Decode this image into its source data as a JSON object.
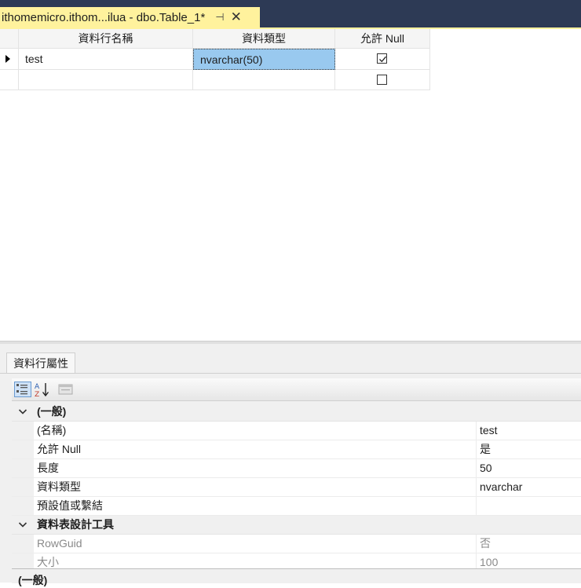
{
  "document_tab": {
    "title": "ithomemicro.ithom...ilua - dbo.Table_1*",
    "pin_icon": "⊣",
    "close_icon": "✕"
  },
  "grid": {
    "headers": [
      "資料行名稱",
      "資料類型",
      "允許 Null"
    ],
    "rows": [
      {
        "name": "test",
        "type": "nvarchar(50)",
        "allow_null": true,
        "current": true
      },
      {
        "name": "",
        "type": "",
        "allow_null": false,
        "current": false
      }
    ]
  },
  "properties": {
    "tab_label": "資料行屬性",
    "toolbar": {
      "categorized_icon": "categorized-icon",
      "alphabetical_icon": "alphabetical-icon",
      "property_pages_icon": "property-pages-icon"
    },
    "categories": [
      {
        "label": "(一般)",
        "items": [
          {
            "name": "(名稱)",
            "value": "test"
          },
          {
            "name": "允許 Null",
            "value": "是"
          },
          {
            "name": "長度",
            "value": "50"
          },
          {
            "name": "資料類型",
            "value": "nvarchar"
          },
          {
            "name": "預設值或繫結",
            "value": ""
          }
        ]
      },
      {
        "label": "資料表設計工具",
        "items": [
          {
            "name": "RowGuid",
            "value": "否",
            "disabled": true
          },
          {
            "name": "大小",
            "value": "100",
            "disabled": true
          }
        ]
      }
    ],
    "description_title": "(一般)"
  },
  "colors": {
    "tab_active": "#fff29d",
    "title_band": "#2d3a55",
    "selected_cell": "#99c9ef"
  }
}
